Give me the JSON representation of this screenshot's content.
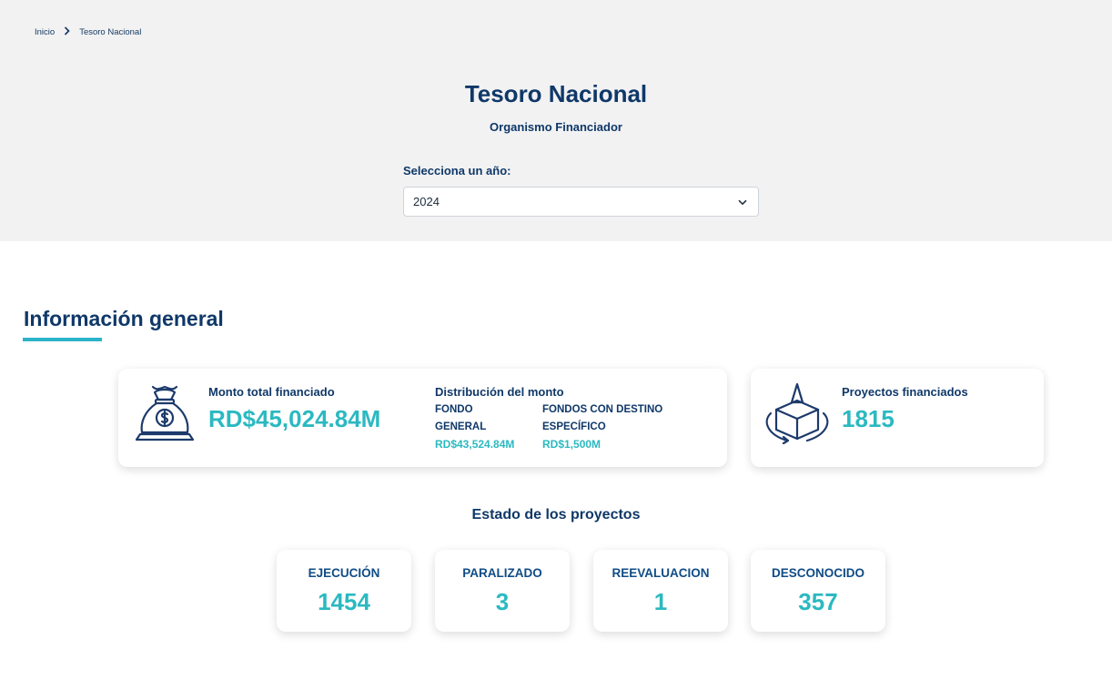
{
  "breadcrumb": {
    "home": "Inicio",
    "separator": ">",
    "current": "Tesoro Nacional"
  },
  "header": {
    "title": "Tesoro Nacional",
    "subtitle": "Organismo Financiador"
  },
  "year_filter": {
    "label": "Selecciona un año:",
    "selected": "2024"
  },
  "section": {
    "title": "Información general"
  },
  "funding_card": {
    "icon": "money-bag-icon",
    "total_label": "Monto total financiado",
    "total_value": "RD$45,024.84M",
    "distribution_label": "Distribución del monto",
    "general_fund_label_line1": "FONDO",
    "general_fund_label_line2": "GENERAL",
    "general_fund_value": "RD$43,524.84M",
    "specific_fund_label_line1": "FONDOS CON DESTINO",
    "specific_fund_label_line2": "ESPECÍFICO",
    "specific_fund_value": "RD$1,500M"
  },
  "projects_card": {
    "icon": "box-project-icon",
    "label": "Proyectos financiados",
    "value": "1815"
  },
  "status": {
    "title": "Estado de los proyectos",
    "items": [
      {
        "label": "EJECUCIÓN",
        "value": "1454"
      },
      {
        "label": "PARALIZADO",
        "value": "3"
      },
      {
        "label": "REEVALUACION",
        "value": "1"
      },
      {
        "label": "DESCONOCIDO",
        "value": "357"
      }
    ]
  },
  "colors": {
    "navy": "#0f3868",
    "accent": "#2bb9c1",
    "hero_bg": "#f2f2f3"
  }
}
